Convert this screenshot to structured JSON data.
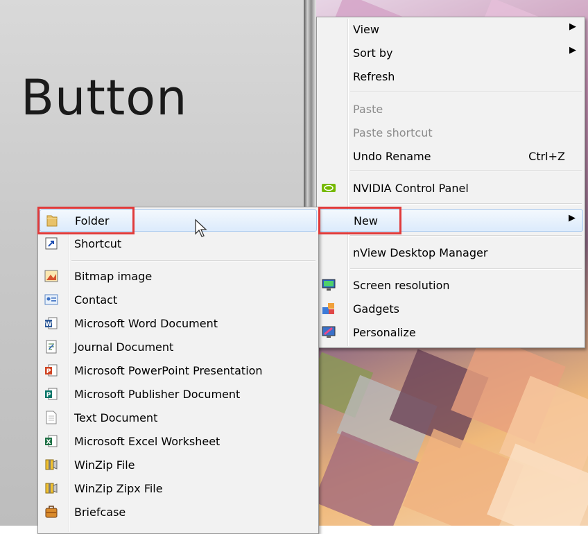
{
  "slide": {
    "title": "Button"
  },
  "context_menu": {
    "items": [
      {
        "label": "View",
        "submenu": true
      },
      {
        "label": "Sort by",
        "submenu": true
      },
      {
        "label": "Refresh"
      },
      {
        "label": "Paste",
        "disabled": true
      },
      {
        "label": "Paste shortcut",
        "disabled": true
      },
      {
        "label": "Undo Rename",
        "shortcut": "Ctrl+Z"
      },
      {
        "label": "NVIDIA Control Panel",
        "icon": "nvidia-icon"
      },
      {
        "label": "New",
        "submenu": true,
        "highlighted": true
      },
      {
        "label": "nView Desktop Manager"
      },
      {
        "label": "Screen resolution",
        "icon": "monitor-icon"
      },
      {
        "label": "Gadgets",
        "icon": "gadgets-icon"
      },
      {
        "label": "Personalize",
        "icon": "personalize-icon"
      }
    ]
  },
  "new_submenu": {
    "items": [
      {
        "label": "Folder",
        "icon": "folder-icon",
        "highlighted": true
      },
      {
        "label": "Shortcut",
        "icon": "shortcut-icon"
      },
      {
        "label": "Bitmap image",
        "icon": "bitmap-icon"
      },
      {
        "label": "Contact",
        "icon": "contact-icon"
      },
      {
        "label": "Microsoft Word Document",
        "icon": "word-icon"
      },
      {
        "label": "Journal Document",
        "icon": "journal-icon"
      },
      {
        "label": "Microsoft PowerPoint Presentation",
        "icon": "powerpoint-icon"
      },
      {
        "label": "Microsoft Publisher Document",
        "icon": "publisher-icon"
      },
      {
        "label": "Text Document",
        "icon": "text-document-icon"
      },
      {
        "label": "Microsoft Excel Worksheet",
        "icon": "excel-icon"
      },
      {
        "label": "WinZip File",
        "icon": "winzip-icon"
      },
      {
        "label": "WinZip Zipx File",
        "icon": "winzip-zipx-icon"
      },
      {
        "label": "Briefcase",
        "icon": "briefcase-icon"
      }
    ]
  },
  "colors": {
    "highlight_box": "#e03a3a",
    "hover_bg": "#dcebfc",
    "menu_bg": "#f2f2f2"
  }
}
